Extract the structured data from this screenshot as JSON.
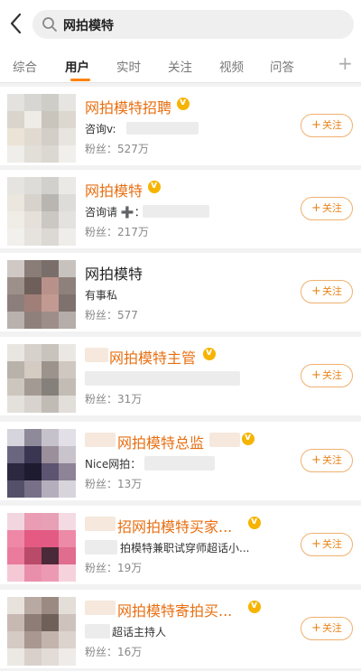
{
  "search": {
    "query": "网拍模特"
  },
  "tabs": [
    {
      "label": "综合",
      "active": false
    },
    {
      "label": "用户",
      "active": true
    },
    {
      "label": "实时",
      "active": false
    },
    {
      "label": "关注",
      "active": false
    },
    {
      "label": "视频",
      "active": false
    },
    {
      "label": "问答",
      "active": false
    }
  ],
  "tabs_more": "+",
  "follow_label": "关注",
  "follow_plus": "+",
  "users": [
    {
      "name": "网拍模特招聘",
      "desc": "咨询v:",
      "fans": "粉丝：527万"
    },
    {
      "name": "网拍模特",
      "desc": "咨询请 ➕：",
      "fans": "粉丝：217万"
    },
    {
      "name": "网拍模特",
      "desc": "有事私",
      "fans": "粉丝：577"
    },
    {
      "name": "网拍模特主管",
      "desc": "",
      "fans": "粉丝：31万"
    },
    {
      "name": "网拍模特总监",
      "desc": "Nice网拍：",
      "fans": "粉丝：13万"
    },
    {
      "name": "招网拍模特买家...",
      "desc": "拍模特兼职试穿师超话小...",
      "fans": "粉丝：19万"
    },
    {
      "name": "网拍模特寄拍买...",
      "desc": "超话主持人",
      "fans": "粉丝：16万"
    }
  ],
  "colors": {
    "accent": "#ff8200",
    "name": "#e86f12",
    "badge": "#f6b400"
  }
}
